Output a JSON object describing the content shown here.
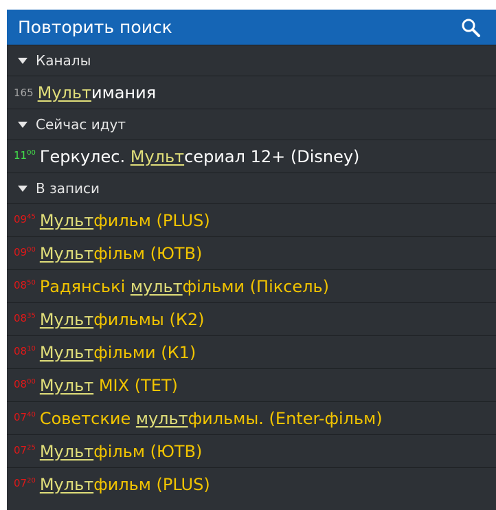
{
  "search": {
    "title": "Повторить поиск",
    "icon": "search-icon"
  },
  "colors": {
    "header_bg": "#1565b5",
    "list_bg": "#2d3136",
    "highlight": "#e0de7a",
    "record_title": "#f2c400",
    "now_time": "#43e24b",
    "record_time": "#e01818"
  },
  "sections": [
    {
      "label": "Каналы"
    },
    {
      "label": "Сейчас идут"
    },
    {
      "label": "В записи"
    }
  ],
  "channels": [
    {
      "number": "165",
      "match": "Мульт",
      "rest": "имания"
    }
  ],
  "now": [
    {
      "hour": "11",
      "min": "00",
      "before": "Геркулес. ",
      "match": "Мульт",
      "rest": "сериал 12+ (Disney)"
    }
  ],
  "recordings": [
    {
      "hour": "09",
      "min": "45",
      "before": "",
      "match": "Мульт",
      "rest": "фильм (PLUS)"
    },
    {
      "hour": "09",
      "min": "00",
      "before": "",
      "match": "Мульт",
      "rest": "фільм (ЮТВ)"
    },
    {
      "hour": "08",
      "min": "50",
      "before": "Радянські ",
      "match": "мульт",
      "rest": "фільми (Піксель)"
    },
    {
      "hour": "08",
      "min": "35",
      "before": "",
      "match": "Мульт",
      "rest": "фильмы (К2)"
    },
    {
      "hour": "08",
      "min": "10",
      "before": "",
      "match": "Мульт",
      "rest": "фільми (К1)"
    },
    {
      "hour": "08",
      "min": "00",
      "before": "",
      "match": "Мульт",
      "rest": " MIX (ТЕТ)"
    },
    {
      "hour": "07",
      "min": "40",
      "before": "Советские ",
      "match": "мульт",
      "rest": "фильмы. (Enter-фільм)"
    },
    {
      "hour": "07",
      "min": "25",
      "before": "",
      "match": "Мульт",
      "rest": "фільм (ЮТВ)"
    },
    {
      "hour": "07",
      "min": "20",
      "before": "",
      "match": "Мульт",
      "rest": "фильм (PLUS)"
    }
  ]
}
